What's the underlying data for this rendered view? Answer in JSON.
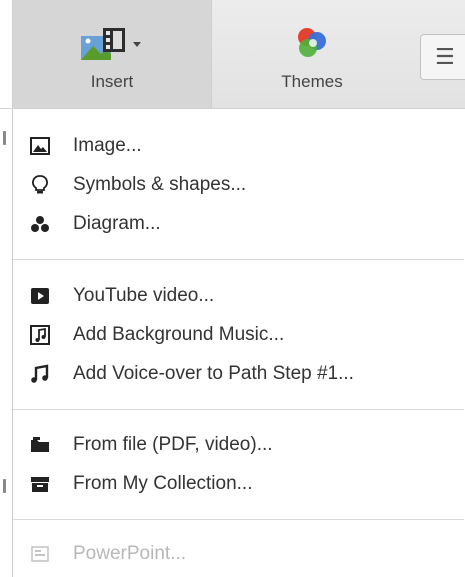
{
  "toolbar": {
    "insert": {
      "label": "Insert",
      "icon": "insert-media-icon"
    },
    "themes": {
      "label": "Themes",
      "icon": "themes-palette-icon"
    },
    "menu": {
      "icon": "hamburger-icon"
    }
  },
  "menu": {
    "groups": [
      [
        {
          "label": "Image...",
          "icon": "image-icon"
        },
        {
          "label": "Symbols & shapes...",
          "icon": "lightbulb-icon"
        },
        {
          "label": "Diagram...",
          "icon": "diagram-icon"
        }
      ],
      [
        {
          "label": "YouTube video...",
          "icon": "youtube-play-icon"
        },
        {
          "label": "Add Background Music...",
          "icon": "music-file-icon"
        },
        {
          "label": "Add Voice-over to Path Step #1...",
          "icon": "music-note-icon"
        }
      ],
      [
        {
          "label": "From file (PDF, video)...",
          "icon": "folder-icon"
        },
        {
          "label": "From My Collection...",
          "icon": "collection-box-icon"
        }
      ],
      [
        {
          "label": "PowerPoint...",
          "icon": "powerpoint-icon",
          "disabled": true
        }
      ]
    ]
  }
}
